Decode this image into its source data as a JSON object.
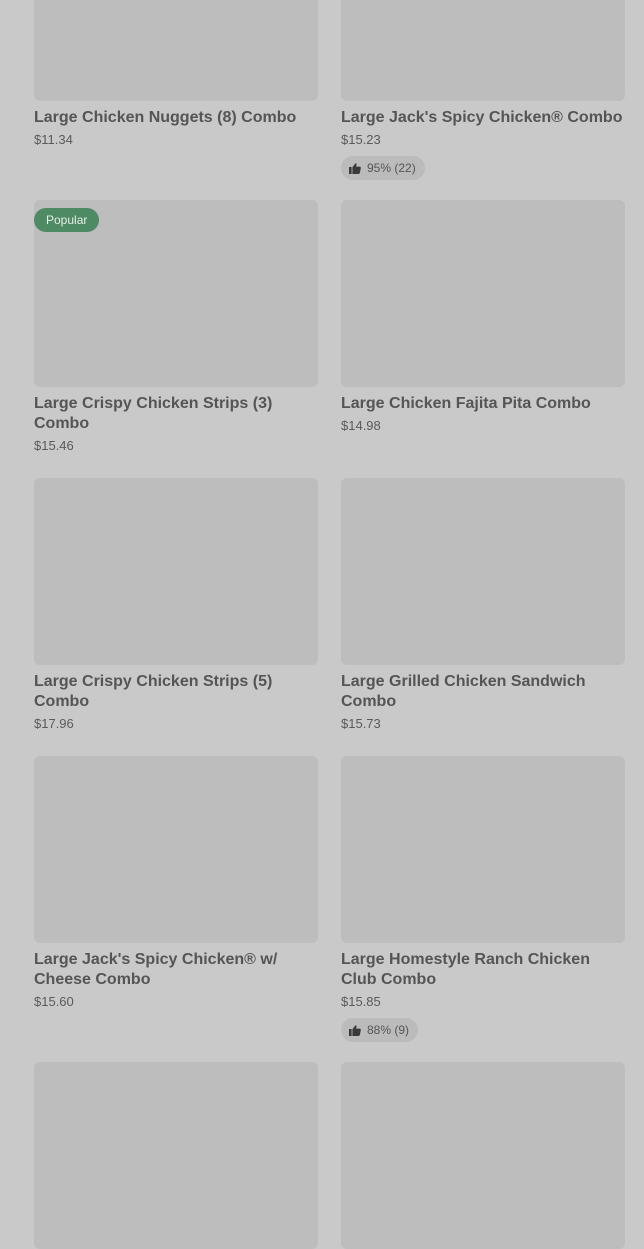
{
  "menu": {
    "items": [
      {
        "name": "Large Chicken Nuggets (8) Combo",
        "price": "$11.34"
      },
      {
        "name": "Large Jack's Spicy Chicken® Combo",
        "price": "$15.23",
        "rating": "95% (22)"
      },
      {
        "name": "Large Crispy Chicken Strips (3) Combo",
        "price": "$15.46",
        "badge": "Popular"
      },
      {
        "name": "Large Chicken Fajita Pita Combo",
        "price": "$14.98"
      },
      {
        "name": "Large Crispy Chicken Strips (5) Combo",
        "price": "$17.96"
      },
      {
        "name": "Large Grilled Chicken Sandwich Combo",
        "price": "$15.73"
      },
      {
        "name": "Large Jack's Spicy Chicken® w/ Cheese Combo",
        "price": "$15.60"
      },
      {
        "name": "Large Homestyle Ranch Chicken Club Combo",
        "price": "$15.85",
        "rating": "88% (9)"
      }
    ]
  },
  "icons": {
    "rating": "thumbs-up-icon"
  },
  "colors": {
    "badge_background": "#4e8a63",
    "page_background": "#c9c9c9",
    "image_placeholder": "#bdbdbd"
  }
}
